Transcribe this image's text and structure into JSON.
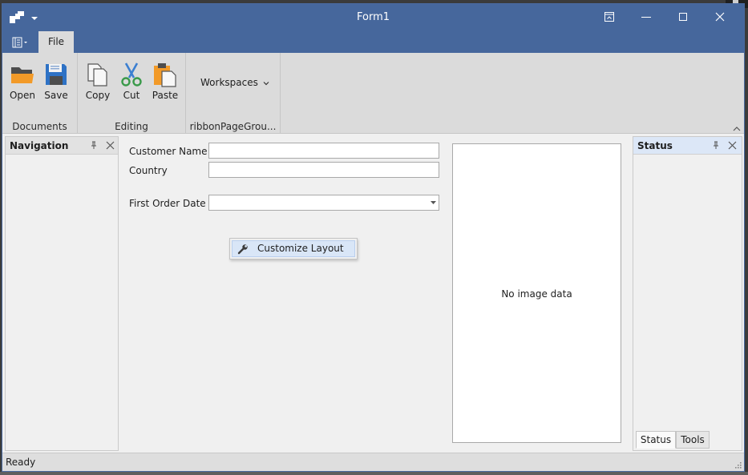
{
  "window": {
    "title": "Form1"
  },
  "ribbon": {
    "tabs": [
      {
        "label": "File"
      }
    ],
    "groups": [
      {
        "label": "Documents",
        "buttons": [
          {
            "label": "Open",
            "icon": "folder-open-icon"
          },
          {
            "label": "Save",
            "icon": "floppy-disk-icon"
          }
        ]
      },
      {
        "label": "Editing",
        "buttons": [
          {
            "label": "Copy",
            "icon": "copy-icon"
          },
          {
            "label": "Cut",
            "icon": "scissors-icon"
          },
          {
            "label": "Paste",
            "icon": "clipboard-paste-icon"
          }
        ]
      },
      {
        "label": "ribbonPageGrou...",
        "gallery": {
          "label": "Workspaces"
        }
      }
    ]
  },
  "navigation_panel": {
    "title": "Navigation"
  },
  "status_panel": {
    "title": "Status",
    "tabs": [
      {
        "label": "Status"
      },
      {
        "label": "Tools"
      }
    ]
  },
  "form": {
    "fields": [
      {
        "label": "Customer Name",
        "value": ""
      },
      {
        "label": "Country",
        "value": ""
      },
      {
        "label": "First Order Date",
        "value": ""
      }
    ],
    "context_menu": {
      "item_label": "Customize Layout",
      "icon": "wrench-icon"
    },
    "picture": {
      "empty_text": "No image data"
    }
  },
  "statusbar": {
    "text": "Ready"
  },
  "colors": {
    "title_bar": "#46679c",
    "ribbon": "#dbdbdb",
    "active_panel_header": "#dce7f7",
    "menu_highlight": "#d9e6f7"
  }
}
